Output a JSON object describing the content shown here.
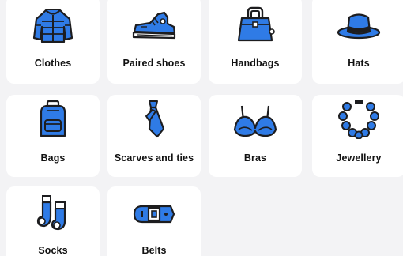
{
  "colors": {
    "accent": "#2f7be6",
    "outline": "#1d1d1f",
    "card": "#ffffff",
    "background": "#f3f3f5"
  },
  "categories": [
    {
      "label": "Clothes",
      "icon": "jacket-icon"
    },
    {
      "label": "Paired shoes",
      "icon": "sneaker-icon"
    },
    {
      "label": "Handbags",
      "icon": "handbag-icon"
    },
    {
      "label": "Hats",
      "icon": "hat-icon"
    },
    {
      "label": "Bags",
      "icon": "backpack-icon"
    },
    {
      "label": "Scarves and ties",
      "icon": "tie-icon"
    },
    {
      "label": "Bras",
      "icon": "bra-icon"
    },
    {
      "label": "Jewellery",
      "icon": "necklace-icon"
    },
    {
      "label": "Socks",
      "icon": "socks-icon"
    },
    {
      "label": "Belts",
      "icon": "belt-icon"
    }
  ]
}
